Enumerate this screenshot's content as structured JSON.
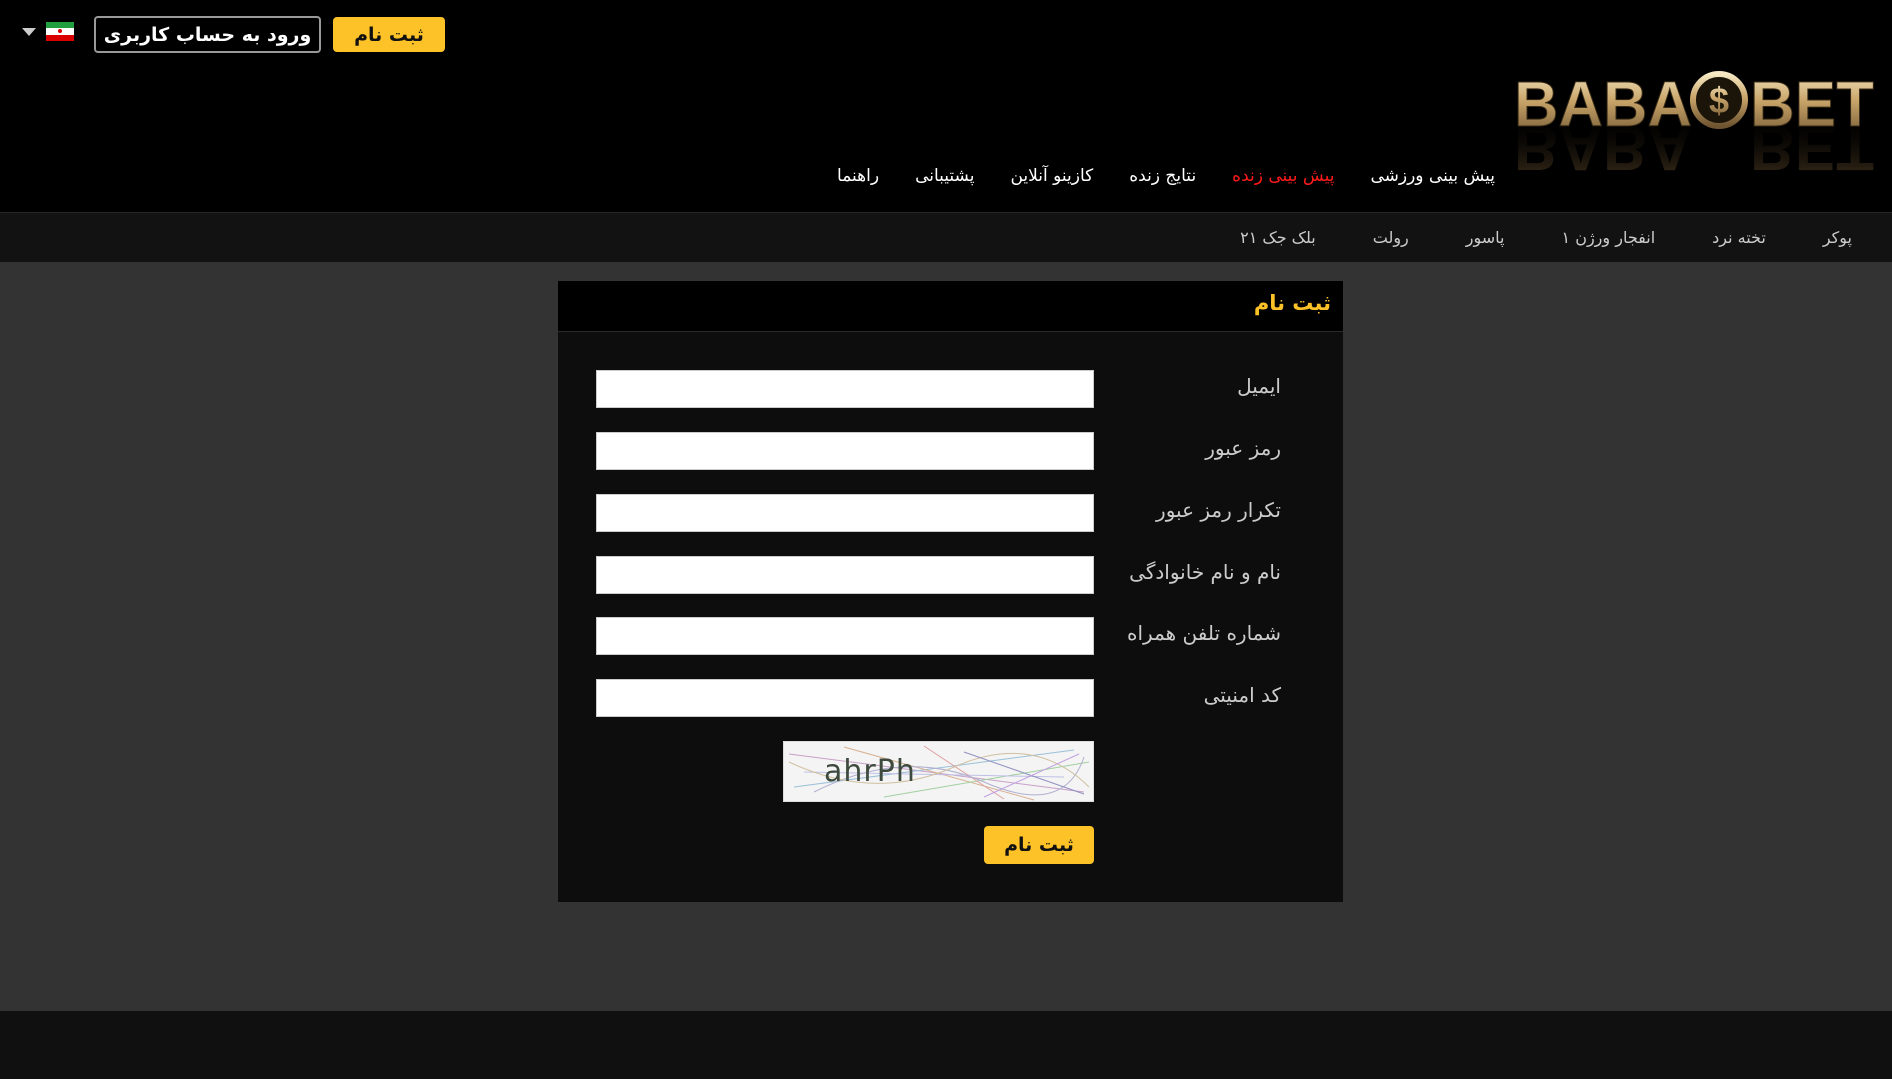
{
  "header": {
    "register_button": "ثبت نام",
    "login_button": "ورود به حساب کاربری",
    "logo_text": "BABA$BET",
    "language_flag": "iran-flag-icon",
    "dropdown_icon": "caret-down-icon"
  },
  "main_nav": [
    {
      "label": "پیش بینی ورزشی",
      "active": false
    },
    {
      "label": "پیش بینی زنده",
      "active": true
    },
    {
      "label": "نتایج زنده",
      "active": false
    },
    {
      "label": "کازینو آنلاین",
      "active": false
    },
    {
      "label": "پشتیبانی",
      "active": false
    },
    {
      "label": "راهنما",
      "active": false
    }
  ],
  "sub_nav": [
    "پوکر",
    "تخته نرد",
    "انفجار ورژن ۱",
    "پاسور",
    "رولت",
    "بلک جک ۲۱"
  ],
  "form": {
    "title": "ثبت نام",
    "fields": [
      {
        "label": "ایمیل",
        "value": ""
      },
      {
        "label": "رمز عبور",
        "value": ""
      },
      {
        "label": "تکرار رمز عبور",
        "value": ""
      },
      {
        "label": "نام و نام خانوادگی",
        "value": ""
      },
      {
        "label": "شماره تلفن همراه",
        "value": ""
      },
      {
        "label": "کد امنیتی",
        "value": ""
      }
    ],
    "captcha_text": "ahrPh",
    "submit_label": "ثبت نام"
  },
  "colors": {
    "accent": "#fdc228",
    "active_nav": "#ff1a1a",
    "background": "#333333"
  }
}
